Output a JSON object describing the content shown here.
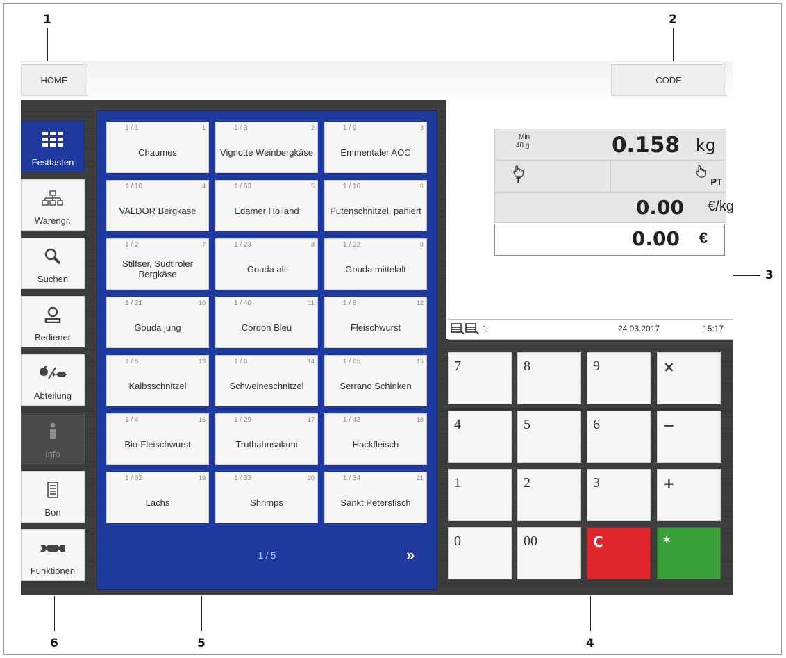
{
  "callouts": [
    "1",
    "2",
    "3",
    "4",
    "5",
    "6"
  ],
  "header": {
    "home_label": "HOME",
    "code_label": "CODE"
  },
  "sidebar": {
    "items": [
      {
        "label": "Festtasten",
        "icon": "grid-icon",
        "state": "active"
      },
      {
        "label": "Warengr.",
        "icon": "hierarchy-icon",
        "state": "normal"
      },
      {
        "label": "Suchen",
        "icon": "search-icon",
        "state": "normal"
      },
      {
        "label": "Bediener",
        "icon": "user-icon",
        "state": "normal"
      },
      {
        "label": "Abteilung",
        "icon": "department-icon",
        "state": "normal"
      },
      {
        "label": "Info",
        "icon": "info-icon",
        "state": "disabled"
      },
      {
        "label": "Bon",
        "icon": "receipt-icon",
        "state": "normal"
      },
      {
        "label": "Funktionen",
        "icon": "wrench-icon",
        "state": "normal"
      }
    ]
  },
  "products": [
    {
      "plu": "1 / 1",
      "pos": "1",
      "name": "Chaumes"
    },
    {
      "plu": "1 / 3",
      "pos": "2",
      "name": "Vignotte Weinbergkäse"
    },
    {
      "plu": "1 / 9",
      "pos": "3",
      "name": "Emmentaler AOC"
    },
    {
      "plu": "1 / 10",
      "pos": "4",
      "name": "VALDOR Bergkäse"
    },
    {
      "plu": "1 / 63",
      "pos": "5",
      "name": "Edamer Holland"
    },
    {
      "plu": "1 / 16",
      "pos": "6",
      "name": "Putenschnitzel, paniert"
    },
    {
      "plu": "1 / 2",
      "pos": "7",
      "name": "Stilfser, Südtiroler Bergkäse"
    },
    {
      "plu": "1 / 23",
      "pos": "8",
      "name": "Gouda alt"
    },
    {
      "plu": "1 / 22",
      "pos": "9",
      "name": "Gouda mittelalt"
    },
    {
      "plu": "1 / 21",
      "pos": "10",
      "name": "Gouda jung"
    },
    {
      "plu": "1 / 40",
      "pos": "11",
      "name": "Cordon Bleu"
    },
    {
      "plu": "1 / 8",
      "pos": "12",
      "name": "Fleischwurst"
    },
    {
      "plu": "1 / 5",
      "pos": "13",
      "name": "Kalbsschnitzel"
    },
    {
      "plu": "1 / 6",
      "pos": "14",
      "name": "Schweineschnitzel"
    },
    {
      "plu": "1 / 65",
      "pos": "15",
      "name": "Serrano Schinken"
    },
    {
      "plu": "1 / 4",
      "pos": "16",
      "name": "Bio-Fleischwurst"
    },
    {
      "plu": "1 / 29",
      "pos": "17",
      "name": "Truthahnsalami"
    },
    {
      "plu": "1 / 42",
      "pos": "18",
      "name": "Hackfleisch"
    },
    {
      "plu": "1 / 32",
      "pos": "19",
      "name": "Lachs"
    },
    {
      "plu": "1 / 33",
      "pos": "20",
      "name": "Shrimps"
    },
    {
      "plu": "1 / 34",
      "pos": "21",
      "name": "Sankt Petersfisch"
    }
  ],
  "pager": {
    "text": "1 / 5",
    "next": "»"
  },
  "scale": {
    "min_label": "Min",
    "min_value": "40 g",
    "weight": "0.158",
    "weight_unit": "kg",
    "tare_icon": "tare-hand-icon",
    "tare_sub": "T",
    "preset_tare_sub": "PT",
    "unit_price": "0.00",
    "unit_price_unit": "€/kg",
    "total": "0.00",
    "total_unit": "€"
  },
  "status": {
    "operator_count": "1",
    "date": "24.03.2017",
    "time": "15:17"
  },
  "keypad": [
    {
      "label": "7",
      "kind": "digit"
    },
    {
      "label": "8",
      "kind": "digit"
    },
    {
      "label": "9",
      "kind": "digit"
    },
    {
      "label": "×",
      "kind": "op"
    },
    {
      "label": "4",
      "kind": "digit"
    },
    {
      "label": "5",
      "kind": "digit"
    },
    {
      "label": "6",
      "kind": "digit"
    },
    {
      "label": "−",
      "kind": "op"
    },
    {
      "label": "1",
      "kind": "digit"
    },
    {
      "label": "2",
      "kind": "digit"
    },
    {
      "label": "3",
      "kind": "digit"
    },
    {
      "label": "+",
      "kind": "op"
    },
    {
      "label": "0",
      "kind": "digit"
    },
    {
      "label": "00",
      "kind": "digit"
    },
    {
      "label": "C",
      "kind": "clear"
    },
    {
      "label": "*",
      "kind": "enter"
    }
  ],
  "colors": {
    "grid_blue": "#1f3a9e",
    "clear_red": "#e0262a",
    "enter_green": "#3aa13a"
  }
}
